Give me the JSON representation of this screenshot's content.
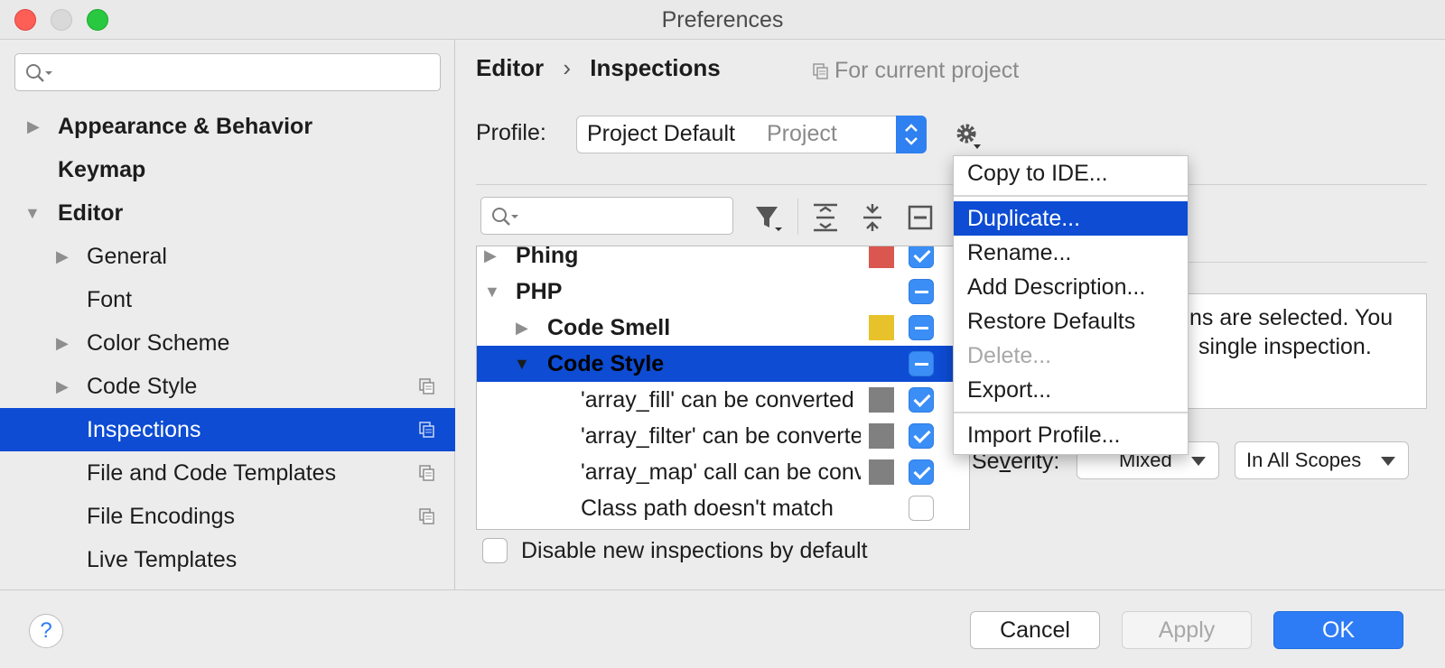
{
  "window": {
    "title": "Preferences"
  },
  "sidebar": {
    "search": {
      "value": ""
    },
    "items": [
      {
        "label": "Appearance & Behavior"
      },
      {
        "label": "Keymap"
      },
      {
        "label": "Editor"
      },
      {
        "label": "General"
      },
      {
        "label": "Font"
      },
      {
        "label": "Color Scheme"
      },
      {
        "label": "Code Style"
      },
      {
        "label": "Inspections"
      },
      {
        "label": "File and Code Templates"
      },
      {
        "label": "File Encodings"
      },
      {
        "label": "Live Templates"
      }
    ]
  },
  "breadcrumb": {
    "parent": "Editor",
    "separator": "›",
    "current": "Inspections"
  },
  "scope_hint": "For current project",
  "profile": {
    "label": "Profile:",
    "name": "Project Default",
    "type": "Project"
  },
  "tree": {
    "rows": [
      {
        "label": "Phing",
        "swatch": "#d9574f",
        "state": "checked"
      },
      {
        "label": "PHP",
        "state": "mixed"
      },
      {
        "label": "Code Smell",
        "swatch": "#e8c22a",
        "state": "mixed"
      },
      {
        "label": "Code Style",
        "state": "mixed"
      },
      {
        "label": "'array_fill' can be converted",
        "swatch": "#808080",
        "state": "checked"
      },
      {
        "label": "'array_filter' can be converted",
        "swatch": "#808080",
        "state": "checked"
      },
      {
        "label": "'array_map' call can be converted",
        "swatch": "#808080",
        "state": "checked"
      },
      {
        "label": "Class path doesn't match",
        "state": "unchecked"
      }
    ]
  },
  "description": {
    "line1": "ns are selected. You",
    "line2": "single inspection."
  },
  "severity": {
    "label_pre": "Se",
    "label_mnemonic": "v",
    "label_post": "erity:",
    "value": "Mixed",
    "scope": "In All Scopes"
  },
  "disable_new": {
    "label": "Disable new inspections by default",
    "checked": false
  },
  "menu": {
    "items": [
      {
        "label": "Copy to IDE..."
      },
      {
        "label": "Duplicate..."
      },
      {
        "label": "Rename..."
      },
      {
        "label": "Add Description..."
      },
      {
        "label": "Restore Defaults"
      },
      {
        "label": "Delete..."
      },
      {
        "label": "Export..."
      },
      {
        "label": "Import Profile..."
      }
    ]
  },
  "footer": {
    "help": "?",
    "cancel": "Cancel",
    "apply": "Apply",
    "ok": "OK"
  },
  "colors": {
    "accent": "#0d4cd3",
    "ok_button": "#2d7cf6"
  }
}
